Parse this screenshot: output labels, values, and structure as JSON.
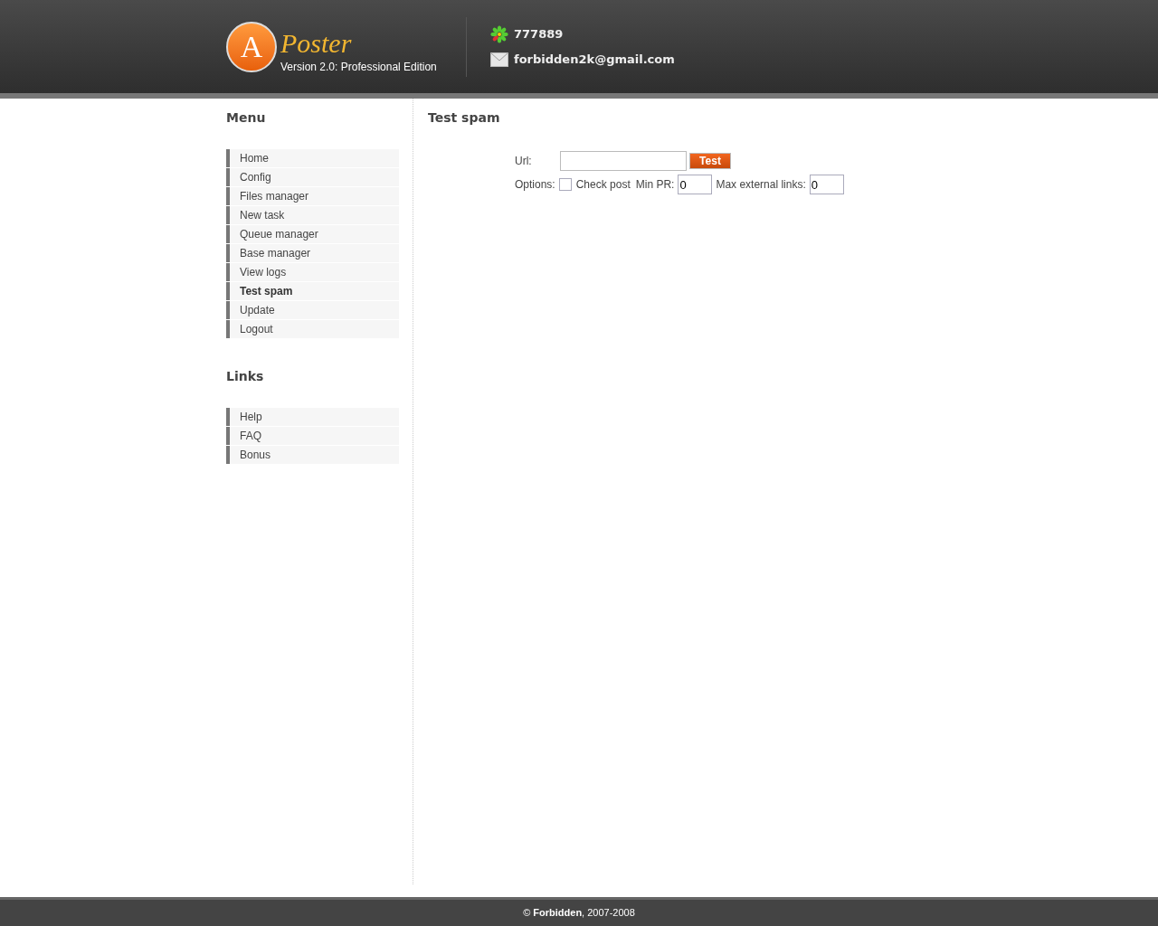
{
  "header": {
    "logo": {
      "letter": "A",
      "name": "Poster",
      "version": "Version 2.0: Professional Edition"
    },
    "contacts": [
      {
        "kind": "icq",
        "text": "777889"
      },
      {
        "kind": "email",
        "text": "forbidden2k@gmail.com"
      }
    ]
  },
  "sidebar": {
    "sections": [
      {
        "title": "Menu",
        "items": [
          {
            "label": "Home",
            "selected": false
          },
          {
            "label": "Config",
            "selected": false
          },
          {
            "label": "Files manager",
            "selected": false
          },
          {
            "label": "New task",
            "selected": false
          },
          {
            "label": "Queue manager",
            "selected": false
          },
          {
            "label": "Base manager",
            "selected": false
          },
          {
            "label": "View logs",
            "selected": false
          },
          {
            "label": "Test spam",
            "selected": true
          },
          {
            "label": "Update",
            "selected": false
          },
          {
            "label": "Logout",
            "selected": false
          }
        ]
      },
      {
        "title": "Links",
        "items": [
          {
            "label": "Help",
            "selected": false
          },
          {
            "label": "FAQ",
            "selected": false
          },
          {
            "label": "Bonus",
            "selected": false
          }
        ]
      }
    ]
  },
  "main": {
    "title": "Test spam",
    "url_label": "Url:",
    "test_button": "Test",
    "options_label": "Options:",
    "check_post": {
      "label": "Check post",
      "checked": false
    },
    "min_pr": {
      "label": "Min PR:",
      "value": "0"
    },
    "max_links": {
      "label": "Max external links:",
      "value": "0"
    }
  },
  "footer": "© **Forbidden**, 2007-2008"
}
